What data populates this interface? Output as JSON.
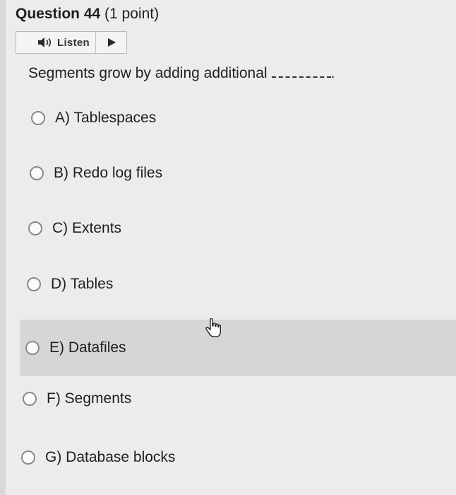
{
  "question": {
    "title": "Question 44",
    "points": "(1 point)",
    "text": "Segments grow by adding additional",
    "blank_suffix": "."
  },
  "listen": {
    "label": "Listen",
    "speaker_icon": "speaker-icon",
    "play_icon": "play-icon"
  },
  "options": [
    {
      "label": "A) Tablespaces",
      "selected": false
    },
    {
      "label": "B) Redo log files",
      "selected": false
    },
    {
      "label": "C) Extents",
      "selected": false
    },
    {
      "label": "D) Tables",
      "selected": false
    },
    {
      "label": "E) Datafiles",
      "selected": false
    },
    {
      "label": "F) Segments",
      "selected": false
    },
    {
      "label": "G) Database blocks",
      "selected": false
    }
  ],
  "colors": {
    "background": "#ececec",
    "hover_row": "#d6d6d6",
    "radio_border": "#8a8a8a"
  }
}
